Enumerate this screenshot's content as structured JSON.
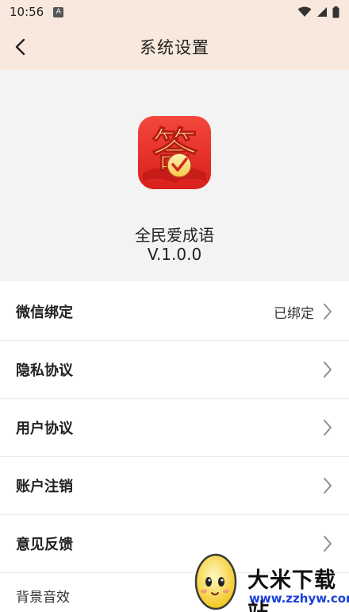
{
  "status_bar": {
    "time": "10:56",
    "badge": "A"
  },
  "header": {
    "title": "系统设置"
  },
  "app": {
    "icon_char": "答",
    "name": "全民爱成语",
    "version": "V.1.0.0"
  },
  "settings": {
    "items": [
      {
        "label": "微信绑定",
        "value": "已绑定"
      },
      {
        "label": "隐私协议"
      },
      {
        "label": "用户协议"
      },
      {
        "label": "账户注销"
      },
      {
        "label": "意见反馈"
      },
      {
        "label": "背景音效"
      }
    ]
  },
  "watermark": {
    "title": "大米下载站",
    "url": "www.zzhyw.com"
  },
  "colors": {
    "header_bg": "#f9e8dd",
    "info_bg": "#f3f3f3",
    "icon_red": "#e8312c",
    "icon_gold": "#ffd966",
    "chevron": "#8e8e9a"
  }
}
